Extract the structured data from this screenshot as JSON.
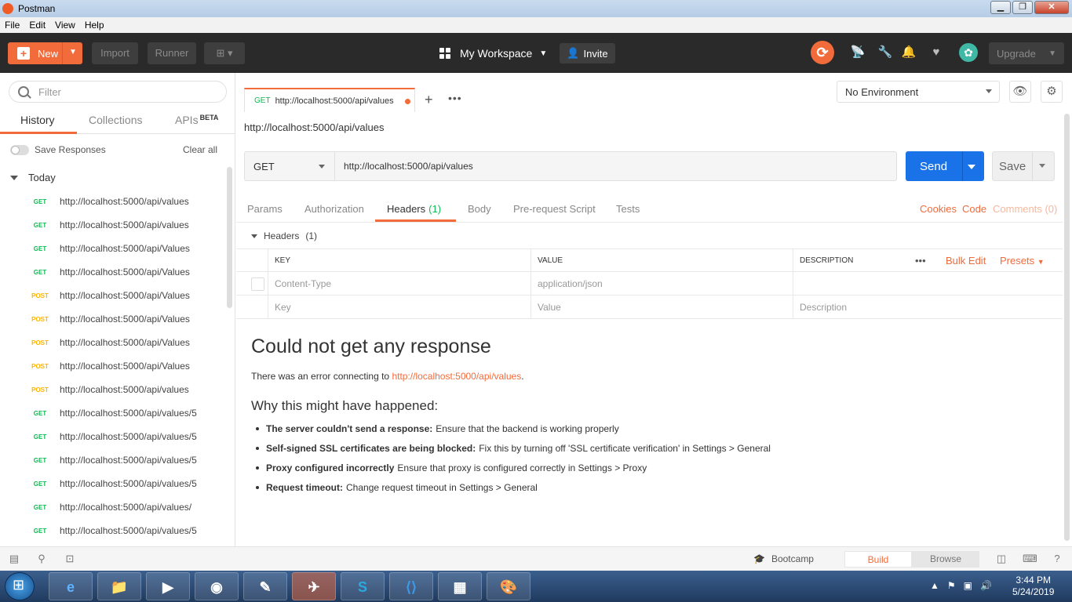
{
  "window": {
    "title": "Postman"
  },
  "menu": [
    "File",
    "Edit",
    "View",
    "Help"
  ],
  "toolbar": {
    "new_label": "New",
    "import_label": "Import",
    "runner_label": "Runner",
    "workspace_label": "My Workspace",
    "invite_label": "Invite",
    "upgrade_label": "Upgrade"
  },
  "sidebar": {
    "filter_placeholder": "Filter",
    "tabs": [
      "History",
      "Collections",
      "APIs"
    ],
    "beta_label": "BETA",
    "save_responses_label": "Save Responses",
    "clear_all_label": "Clear all",
    "group_label": "Today",
    "history": [
      {
        "method": "GET",
        "url": "http://localhost:5000/api/values"
      },
      {
        "method": "GET",
        "url": "http://localhost:5000/api/values"
      },
      {
        "method": "GET",
        "url": "http://localhost:5000/api/Values"
      },
      {
        "method": "GET",
        "url": "http://localhost:5000/api/Values"
      },
      {
        "method": "POST",
        "url": "http://localhost:5000/api/Values"
      },
      {
        "method": "POST",
        "url": "http://localhost:5000/api/Values"
      },
      {
        "method": "POST",
        "url": "http://localhost:5000/api/Values"
      },
      {
        "method": "POST",
        "url": "http://localhost:5000/api/Values"
      },
      {
        "method": "POST",
        "url": "http://localhost:5000/api/values"
      },
      {
        "method": "GET",
        "url": "http://localhost:5000/api/values/5"
      },
      {
        "method": "GET",
        "url": "http://localhost:5000/api/values/5"
      },
      {
        "method": "GET",
        "url": "http://localhost:5000/api/values/5"
      },
      {
        "method": "GET",
        "url": "http://localhost:5000/api/values/5"
      },
      {
        "method": "GET",
        "url": "http://localhost:5000/api/values/"
      },
      {
        "method": "GET",
        "url": "http://localhost:5000/api/values/5"
      }
    ]
  },
  "request_tab": {
    "method": "GET",
    "url": "http://localhost:5000/api/values"
  },
  "environment": {
    "selected": "No Environment"
  },
  "request": {
    "title": "http://localhost:5000/api/values",
    "method": "GET",
    "url": "http://localhost:5000/api/values",
    "send_label": "Send",
    "save_label": "Save"
  },
  "request_tabs": {
    "params": "Params",
    "authorization": "Authorization",
    "headers": "Headers",
    "headers_count": "(1)",
    "body": "Body",
    "prerequest": "Pre-request Script",
    "tests": "Tests",
    "cookies": "Cookies",
    "code": "Code",
    "comments": "Comments (0)"
  },
  "headers": {
    "section_label": "Headers",
    "section_count": "(1)",
    "col_key": "KEY",
    "col_value": "VALUE",
    "col_description": "DESCRIPTION",
    "more_label": "•••",
    "bulk_edit_label": "Bulk Edit",
    "presets_label": "Presets",
    "rows": [
      {
        "key": "Content-Type",
        "value": "application/json",
        "description": ""
      }
    ],
    "placeholder_key": "Key",
    "placeholder_value": "Value",
    "placeholder_description": "Description"
  },
  "error": {
    "title": "Could not get any response",
    "desc_prefix": "There was an error connecting to ",
    "desc_link": "http://localhost:5000/api/values",
    "desc_suffix": ".",
    "why_title": "Why this might have happened:",
    "reasons": [
      {
        "bold": "The server couldn't send a response:",
        "text": "Ensure that the backend is working properly"
      },
      {
        "bold": "Self-signed SSL certificates are being blocked:",
        "text": "Fix this by turning off 'SSL certificate verification' in Settings > General"
      },
      {
        "bold": "Proxy configured incorrectly",
        "text": "Ensure that proxy is configured correctly in Settings > Proxy"
      },
      {
        "bold": "Request timeout:",
        "text": "Change request timeout in Settings > General"
      }
    ]
  },
  "statusbar": {
    "bootcamp_label": "Bootcamp",
    "build_label": "Build",
    "browse_label": "Browse"
  },
  "taskbar": {
    "time": "3:44 PM",
    "date": "5/24/2019"
  },
  "colors": {
    "accent": "#f26b3a",
    "send": "#1a72e8",
    "get": "#0cbb52",
    "post": "#ffb400"
  }
}
